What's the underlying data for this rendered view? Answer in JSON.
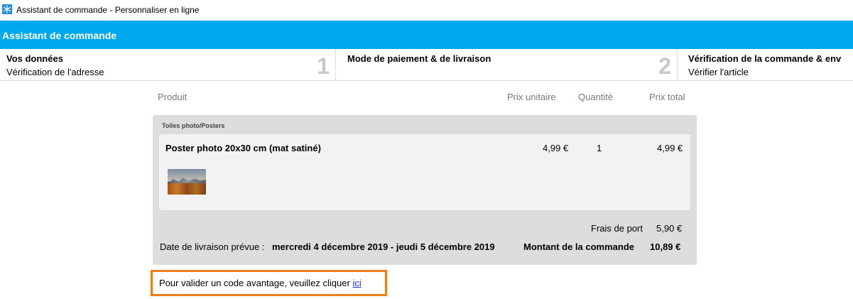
{
  "window": {
    "title": "Assistant de commande - Personnaliser en ligne",
    "icon": "snowflake-app-icon"
  },
  "header": {
    "title": "Assistant de commande",
    "color": "#00a8f0"
  },
  "steps": [
    {
      "title": "Vos données",
      "subtitle": "Vérification de l'adresse",
      "number": "1"
    },
    {
      "title": "Mode de paiement & de livraison",
      "subtitle": "",
      "number": "2"
    },
    {
      "title": "Vérification de la commande & env",
      "subtitle": "Vérifier l'article",
      "number": ""
    }
  ],
  "columns": {
    "product": "Produit",
    "unit_price": "Prix unitaire",
    "quantity": "Quantité",
    "total_price": "Prix total"
  },
  "group": {
    "title": "Toiles photo/Posters",
    "items": [
      {
        "name": "Poster photo 20x30 cm (mat satiné)",
        "unit_price": "4,99 €",
        "quantity": "1",
        "total_price": "4,99 €"
      }
    ]
  },
  "summary": {
    "shipping_label": "Frais de port",
    "shipping_value": "5,90 €",
    "delivery_label": "Date de livraison prévue :",
    "delivery_value": "mercredi 4 décembre 2019 - jeudi 5 décembre 2019",
    "total_label": "Montant de la commande",
    "total_value": "10,89 €"
  },
  "promo": {
    "text": "Pour valider un code avantage, veuillez cliquer",
    "link": "ici",
    "highlight_color": "#f07d1a"
  }
}
